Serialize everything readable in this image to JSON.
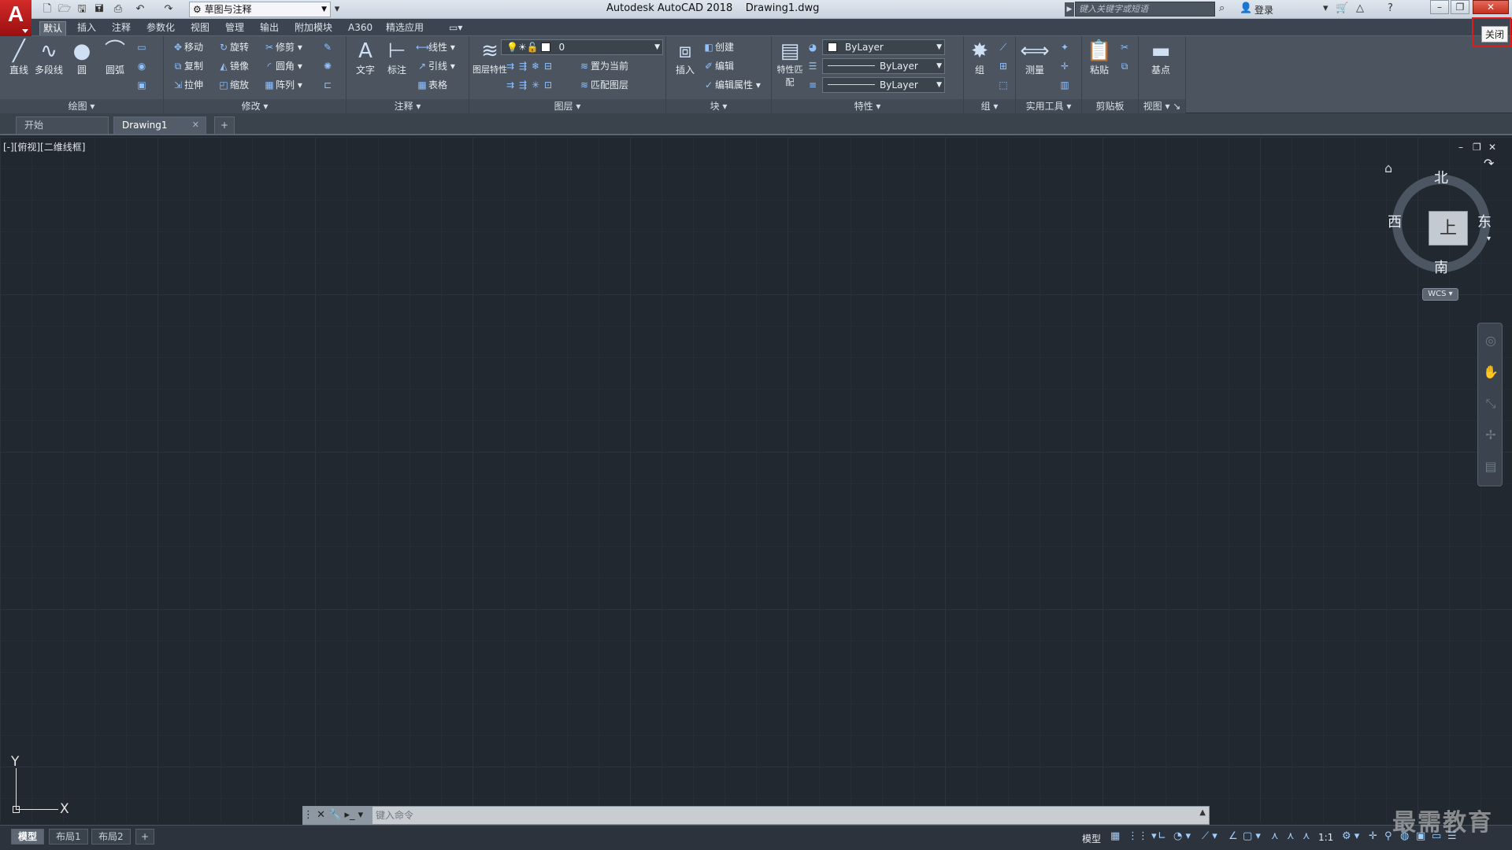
{
  "titlebar": {
    "workspace": "草图与注释",
    "title": "Autodesk AutoCAD 2018    Drawing1.dwg",
    "search_placeholder": "键入关键字或短语",
    "login": "登录",
    "close_tooltip": "关闭"
  },
  "ribbon_tabs": [
    "默认",
    "插入",
    "注释",
    "参数化",
    "视图",
    "管理",
    "输出",
    "附加模块",
    "A360",
    "精选应用"
  ],
  "panels": {
    "draw": {
      "title": "绘图",
      "tools": {
        "line": "直线",
        "polyline": "多段线",
        "circle": "圆",
        "arc": "圆弧"
      }
    },
    "modify": {
      "title": "修改",
      "tools": {
        "move": "移动",
        "rotate": "旋转",
        "trim": "修剪",
        "copy": "复制",
        "mirror": "镜像",
        "fillet": "圆角",
        "stretch": "拉伸",
        "scale": "缩放",
        "array": "阵列"
      }
    },
    "annotation": {
      "title": "注释",
      "tools": {
        "text": "文字",
        "dimension": "标注",
        "linear": "线性",
        "leader": "引线",
        "table": "表格"
      }
    },
    "layers": {
      "title": "图层",
      "tools": {
        "layer_properties": "图层特性",
        "current_layer": "0",
        "set_current": "置为当前",
        "match_layer": "匹配图层"
      }
    },
    "block": {
      "title": "块",
      "tools": {
        "insert": "插入",
        "create": "创建",
        "edit": "编辑",
        "edit_attributes": "编辑属性"
      }
    },
    "properties": {
      "title": "特性",
      "tools": {
        "match_properties": "特性匹配",
        "color": "ByLayer",
        "linetype": "ByLayer",
        "lineweight": "ByLayer"
      }
    },
    "groups": {
      "title": "组",
      "tools": {
        "group": "组"
      }
    },
    "utilities": {
      "title": "实用工具",
      "tools": {
        "measure": "测量"
      }
    },
    "clipboard": {
      "title": "剪贴板",
      "tools": {
        "paste": "粘贴"
      }
    },
    "view": {
      "title": "视图",
      "tools": {
        "base": "基点"
      }
    }
  },
  "file_tabs": {
    "start": "开始",
    "drawing": "Drawing1"
  },
  "viewport": {
    "label": "[-][俯视][二维线框]",
    "compass": {
      "north": "北",
      "south": "南",
      "east": "东",
      "west": "西",
      "face": "上"
    },
    "wcs": "WCS",
    "ucs": {
      "x": "X",
      "y": "Y"
    }
  },
  "command_line": {
    "placeholder": "键入命令"
  },
  "layout_tabs": [
    "模型",
    "布局1",
    "布局2"
  ],
  "status": {
    "model": "模型",
    "scale": "1:1"
  },
  "watermark": "最需教育",
  "colors": {
    "canvas": "#212830",
    "ribbon": "#4b545f",
    "close_red": "#c4301f",
    "highlight_box": "#e01b1b"
  },
  "icons": [
    "app-logo-icon",
    "new-icon",
    "open-icon",
    "save-icon",
    "print-icon",
    "undo-icon",
    "redo-icon",
    "search-icon",
    "user-icon",
    "cart-icon",
    "help-icon",
    "home-icon",
    "pan-icon",
    "zoom-icon",
    "orbit-icon"
  ]
}
